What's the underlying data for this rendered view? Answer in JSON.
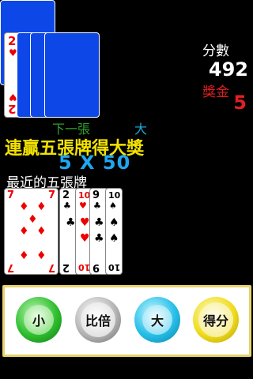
{
  "deck": {
    "front_card": {
      "rank": "2",
      "suit": "♥",
      "color": "#e00000"
    },
    "back_color": "#0d47e8"
  },
  "labels": {
    "next": "下一張",
    "big": "大"
  },
  "score": {
    "label": "分數",
    "value": "492"
  },
  "bonus": {
    "label": "獎金",
    "value": "5"
  },
  "banner": {
    "text": "連贏五張牌得大獎",
    "multiplier": "5 X 50"
  },
  "recent": {
    "label": "最近的五張牌",
    "cards": [
      {
        "rank": "7",
        "suit": "♦",
        "color": "red"
      },
      {
        "rank": "2",
        "suit": "♣",
        "color": "black"
      },
      {
        "rank": "10",
        "suit": "♥",
        "color": "red"
      },
      {
        "rank": "9",
        "suit": "♣",
        "color": "black"
      },
      {
        "rank": "10",
        "suit": "♠",
        "color": "black"
      }
    ]
  },
  "controls": {
    "small": "小",
    "double": "比倍",
    "big": "大",
    "score": "得分"
  },
  "colors": {
    "accent_yellow": "#f2e200",
    "accent_blue": "#1ea7f0",
    "bonus_red": "#e02020",
    "next_green": "#2f9e2f"
  }
}
